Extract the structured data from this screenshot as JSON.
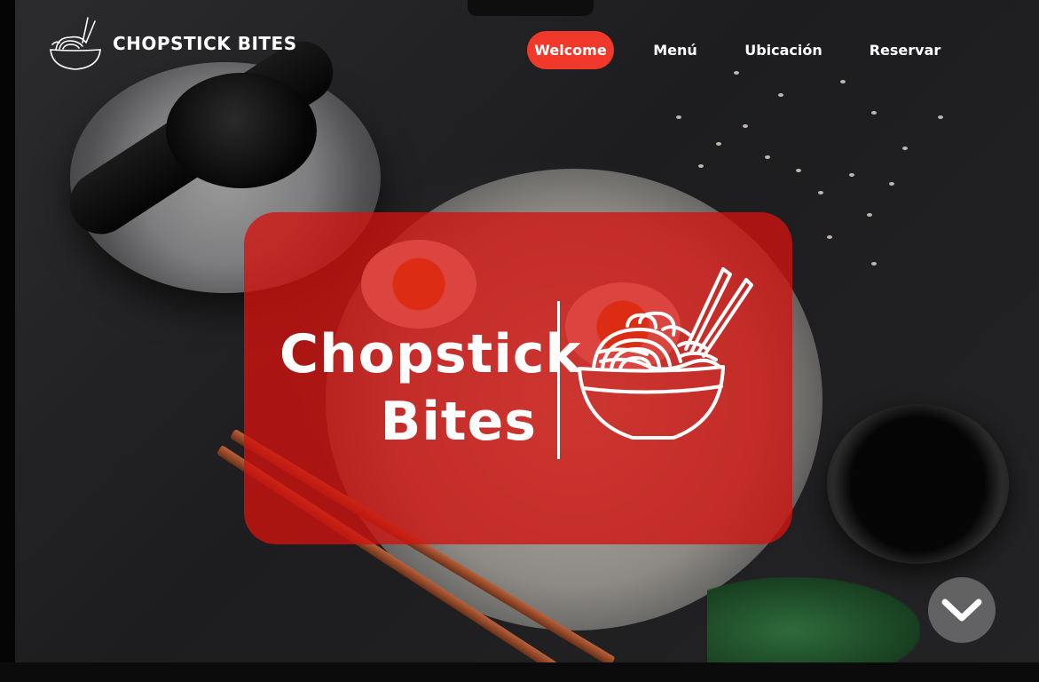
{
  "header": {
    "brand_name": "CHOPSTICK BITES",
    "logo_icon": "ramen-bowl-chopsticks-icon"
  },
  "nav": {
    "items": [
      {
        "label": "Welcome",
        "active": true
      },
      {
        "label": "Menú",
        "active": false
      },
      {
        "label": "Ubicación",
        "active": false
      },
      {
        "label": "Reservar",
        "active": false
      }
    ]
  },
  "hero": {
    "title_line1": "Chopstick",
    "title_line2": "Bites",
    "logo_icon": "ramen-bowl-chopsticks-icon"
  },
  "scroll_button": {
    "icon": "chevron-down-icon"
  },
  "colors": {
    "accent": "#f0392b",
    "hero_overlay": "#d2120e",
    "text": "#ffffff"
  }
}
